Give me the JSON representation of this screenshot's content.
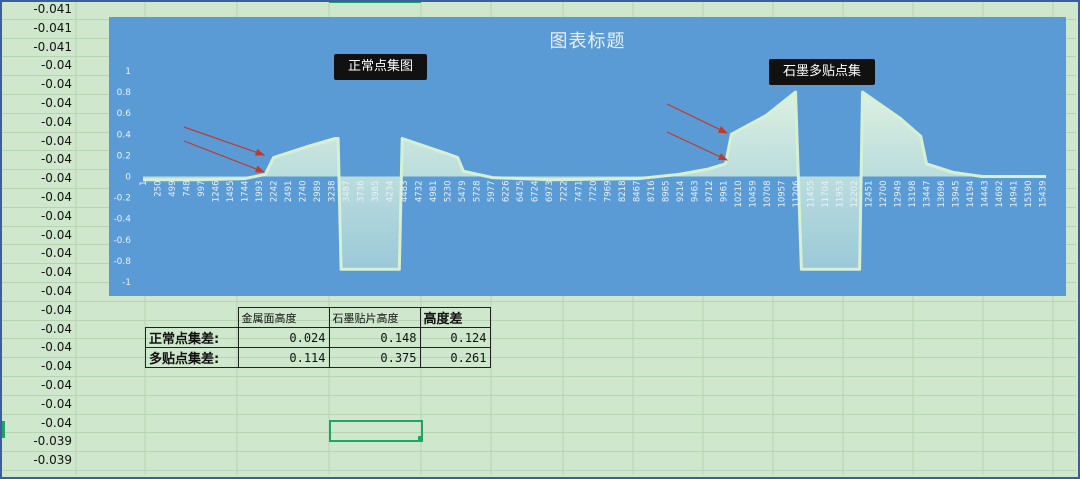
{
  "column_a_values": [
    "-0.041",
    "-0.041",
    "-0.041",
    "-0.04",
    "-0.04",
    "-0.04",
    "-0.04",
    "-0.04",
    "-0.04",
    "-0.04",
    "-0.04",
    "-0.04",
    "-0.04",
    "-0.04",
    "-0.04",
    "-0.04",
    "-0.04",
    "-0.04",
    "-0.04",
    "-0.04",
    "-0.04",
    "-0.04",
    "-0.04",
    "-0.039",
    "-0.039"
  ],
  "chart": {
    "title": "图表标题",
    "callout_left": "正常点集图",
    "callout_right": "石墨多贴点集"
  },
  "chart_data": {
    "type": "area",
    "title": "图表标题",
    "annotations": [
      "正常点集图",
      "石墨多贴点集"
    ],
    "ylim": [
      -1,
      1
    ],
    "y_ticks": [
      "1",
      "0.8",
      "0.6",
      "0.4",
      "0.2",
      "0",
      "-0.2",
      "-0.4",
      "-0.6",
      "-0.8",
      "-1"
    ],
    "x_ticks": [
      "1",
      "250",
      "499",
      "748",
      "997",
      "1246",
      "1495",
      "1744",
      "1993",
      "2242",
      "2491",
      "2740",
      "2989",
      "3238",
      "3487",
      "3736",
      "3985",
      "4234",
      "4483",
      "4732",
      "4981",
      "5230",
      "5479",
      "5728",
      "5977",
      "6226",
      "6475",
      "6724",
      "6973",
      "7222",
      "7471",
      "7720",
      "7969",
      "8218",
      "8467",
      "8716",
      "8965",
      "9214",
      "9463",
      "9712",
      "9961",
      "10210",
      "10459",
      "10708",
      "10957",
      "11206",
      "11455",
      "11704",
      "11953",
      "12202",
      "12451",
      "12700",
      "12949",
      "13198",
      "13447",
      "13696",
      "13945",
      "14194",
      "14443",
      "14692",
      "14941",
      "15190",
      "15439"
    ],
    "series_points": [
      [
        1,
        -0.03
      ],
      [
        997,
        -0.03
      ],
      [
        1744,
        -0.02
      ],
      [
        2100,
        0.02
      ],
      [
        2242,
        0.18
      ],
      [
        2800,
        0.28
      ],
      [
        3300,
        0.36
      ],
      [
        3350,
        0.36
      ],
      [
        3400,
        -0.88
      ],
      [
        4400,
        -0.88
      ],
      [
        4450,
        0.36
      ],
      [
        5200,
        0.22
      ],
      [
        5400,
        0.18
      ],
      [
        5500,
        0.05
      ],
      [
        6000,
        -0.01
      ],
      [
        7000,
        -0.03
      ],
      [
        8500,
        -0.02
      ],
      [
        9200,
        0.02
      ],
      [
        9700,
        0.07
      ],
      [
        10000,
        0.12
      ],
      [
        10100,
        0.4
      ],
      [
        10700,
        0.58
      ],
      [
        11200,
        0.8
      ],
      [
        11300,
        -0.88
      ],
      [
        12300,
        -0.88
      ],
      [
        12350,
        0.8
      ],
      [
        13000,
        0.55
      ],
      [
        13350,
        0.38
      ],
      [
        13447,
        0.12
      ],
      [
        13900,
        0.04
      ],
      [
        14400,
        0.0
      ],
      [
        15000,
        0.0
      ],
      [
        15500,
        0.0
      ]
    ]
  },
  "table": {
    "headers": [
      "金属面高度",
      "石墨贴片高度",
      "高度差"
    ],
    "rows": [
      {
        "label": "正常点集差:",
        "values": [
          "0.024",
          "0.148",
          "0.124"
        ]
      },
      {
        "label": "多贴点集差:",
        "values": [
          "0.114",
          "0.375",
          "0.261"
        ]
      }
    ]
  }
}
